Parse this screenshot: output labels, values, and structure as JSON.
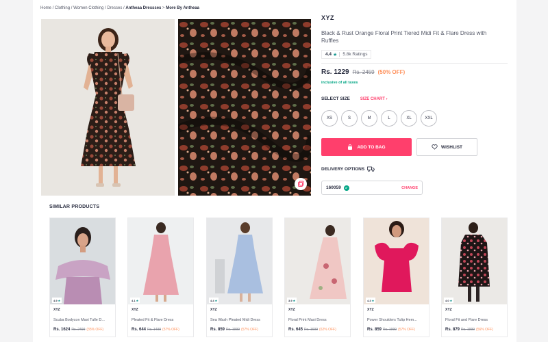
{
  "breadcrumb": {
    "items": [
      "Home",
      "Clothing",
      "Women Clothing",
      "Dresses",
      "Antheaa Dressses",
      "More By Antheaa"
    ],
    "separator": "/"
  },
  "product": {
    "brand": "XYZ",
    "title": "Black & Rust Orange Floral Print Tiered Midi Fit & Flare Dress with Ruffles",
    "rating": "4.4",
    "rating_count": "5.8k Ratings",
    "price": "Rs. 1229",
    "mrp": "Rs. 2459",
    "discount": "(50% OFF)",
    "taxes_note": "inclusive of all taxes"
  },
  "size": {
    "title": "SELECT SIZE",
    "chart_link": "SIZE CHART",
    "options": [
      "XS",
      "S",
      "M",
      "L",
      "XL",
      "XXL"
    ]
  },
  "actions": {
    "add_to_bag": "ADD TO BAG",
    "wishlist": "WISHLIST"
  },
  "delivery": {
    "title": "DELIVERY OPTIONS",
    "pincode": "160059",
    "change": "CHANGE"
  },
  "similar": {
    "title": "SIMILAR PRODUCTS",
    "items": [
      {
        "brand": "XYZ",
        "name": "Scuba Bodycon Maxi Tulle D...",
        "price": "Rs. 1624",
        "mrp": "Rs. 2499",
        "off": "(35% OFF)",
        "rating": "4.9"
      },
      {
        "brand": "XYZ",
        "name": "Pleated Fit & Flare Dress",
        "price": "Rs. 644",
        "mrp": "Rs. 1499",
        "off": "(57% OFF)",
        "rating": "4.1"
      },
      {
        "brand": "XYZ",
        "name": "Sea Wash Pleated Midi Dress",
        "price": "Rs. 859",
        "mrp": "Rs. 1999",
        "off": "(57% OFF)",
        "rating": "4.4"
      },
      {
        "brand": "XYZ",
        "name": "Floral Print Maxi Dress",
        "price": "Rs. 645",
        "mrp": "Rs. 1699",
        "off": "(62% OFF)",
        "rating": "3.9"
      },
      {
        "brand": "XYZ",
        "name": "Power Shoulders Tulip Hem...",
        "price": "Rs. 859",
        "mrp": "Rs. 1999",
        "off": "(57% OFF)",
        "rating": "4.3"
      },
      {
        "brand": "XYZ",
        "name": "Floral Fit and Flare Dress",
        "price": "Rs. 879",
        "mrp": "Rs. 1999",
        "off": "(56% OFF)",
        "rating": "4.0"
      }
    ]
  },
  "colors": {
    "accent": "#ff3f6c",
    "discount": "#ff905a",
    "success": "#03a685",
    "rating_star": "#14958f"
  }
}
